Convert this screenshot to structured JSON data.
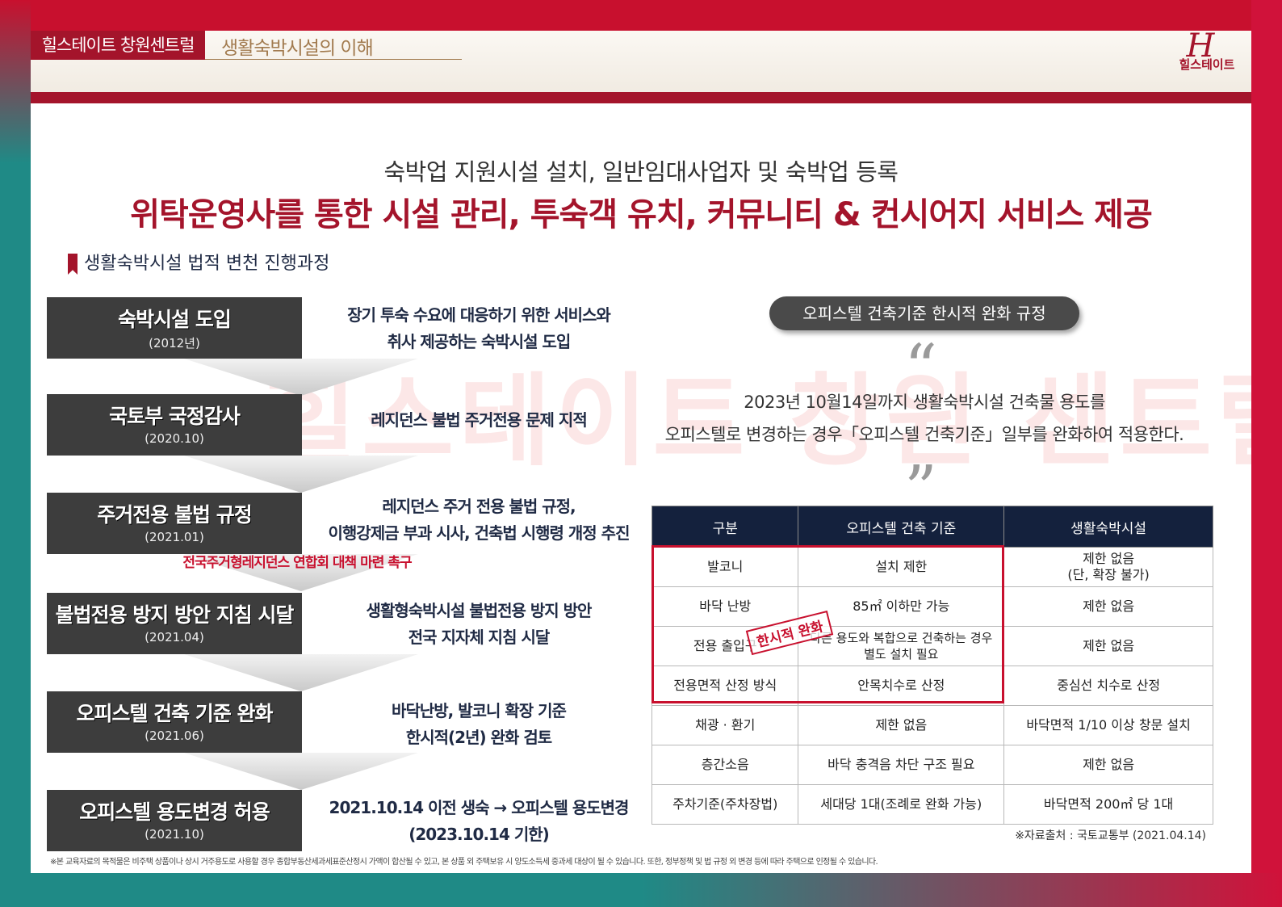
{
  "header": {
    "brand": "힐스테이트 창원센트럴",
    "section": "생활숙박시설의 이해",
    "logo_mark": "H",
    "logo_text": "힐스테이트"
  },
  "headline": {
    "sub": "숙박업 지원시설 설치, 일반임대사업자 및 숙박업 등록",
    "main": "위탁운영사를 통한 시설 관리, 투숙객 유치, 커뮤니티 & 컨시어지 서비스 제공"
  },
  "legal_section_title": "생활숙박시설 법적 변천 진행과정",
  "watermark": "힐스테이트 창원 센트럴",
  "timeline": [
    {
      "title": "숙박시설 도입",
      "date": "(2012년)",
      "desc1": "장기 투숙 수요에 대응하기 위한 서비스와",
      "desc2": "취사 제공하는 숙박시설 도입"
    },
    {
      "title": "국토부 국정감사",
      "date": "(2020.10)",
      "desc1": "레지던스 불법 주거전용 문제 지적",
      "desc2": ""
    },
    {
      "title": "주거전용 불법 규정",
      "date": "(2021.01)",
      "desc1": "레지던스 주거 전용 불법 규정,",
      "desc2": "이행강제금 부과 시사, 건축법 시행령 개정 추진"
    },
    {
      "title": "불법전용 방지 방안 지침 시달",
      "date": "(2021.04)",
      "desc1": "생활형숙박시설 불법전용 방지 방안",
      "desc2": "전국 지자체 지침 시달"
    },
    {
      "title": "오피스텔 건축 기준 완화",
      "date": "(2021.06)",
      "desc1": "바닥난방, 발코니 확장 기준",
      "desc2": "한시적(2년) 완화 검토"
    },
    {
      "title": "오피스텔 용도변경 허용",
      "date": "(2021.10)",
      "desc1": "2021.10.14 이전 생숙 → 오피스텔 용도변경",
      "desc2": "(2023.10.14 기한)"
    }
  ],
  "timeline_note": "전국주거형레지던스 연합회 대책 마련 촉구",
  "regulation": {
    "pill": "오피스텔 건축기준 한시적 완화 규정",
    "quote_open": "“",
    "quote_close": "”",
    "quote_line1": "2023년 10월14일까지 생활숙박시설 건축물 용도를",
    "quote_line2": "오피스텔로 변경하는 경우「오피스텔 건축기준」일부를 완화하여 적용한다.",
    "stamp": "한시적 완화",
    "headers": [
      "구분",
      "오피스텔 건축 기준",
      "생활숙박시설"
    ],
    "rows": [
      {
        "c1": "발코니",
        "c2": "설치 제한",
        "c3a": "제한 없음",
        "c3b": "(단, 확장 불가)",
        "c2b": ""
      },
      {
        "c1": "바닥 난방",
        "c2": "85㎡ 이하만 가능",
        "c3a": "제한 없음",
        "c3b": "",
        "c2b": ""
      },
      {
        "c1": "전용 출입구",
        "c2": "다른 용도와 복합으로 건축하는 경우",
        "c2b": "별도 설치 필요",
        "c3a": "제한 없음",
        "c3b": ""
      },
      {
        "c1": "전용면적 산정 방식",
        "c2": "안목치수로 산정",
        "c3a": "중심선 치수로 산정",
        "c3b": "",
        "c2b": ""
      },
      {
        "c1": "채광 · 환기",
        "c2": "제한 없음",
        "c3a": "바닥면적 1/10 이상 창문 설치",
        "c3b": "",
        "c2b": ""
      },
      {
        "c1": "층간소음",
        "c2": "바닥 충격음 차단 구조 필요",
        "c3a": "제한 없음",
        "c3b": "",
        "c2b": ""
      },
      {
        "c1": "주차기준(주차장법)",
        "c2": "세대당 1대(조례로 완화 가능)",
        "c3a": "바닥면적 200㎡ 당 1대",
        "c3b": "",
        "c2b": ""
      }
    ],
    "source": "※자료출처 : 국토교통부 (2021.04.14)"
  },
  "footnote": "※본 교육자료의 목적물은 비주택 상품이나 상시 거주용도로 사용할 경우 종합부동산세과세표준산정시 가액이 합산될 수 있고, 본 상품 외 주택보유 시 양도소득세 중과세 대상이 될 수 있습니다. 또한, 정부정책 및 법 규정 외 변경 등에 따라 주택으로 인정될 수 있습니다.",
  "colors": {
    "brand_red": "#a4142b",
    "accent_red": "#c8102e",
    "navy": "#14213d",
    "teal": "#1f8a86",
    "gold": "#a27b4f"
  }
}
